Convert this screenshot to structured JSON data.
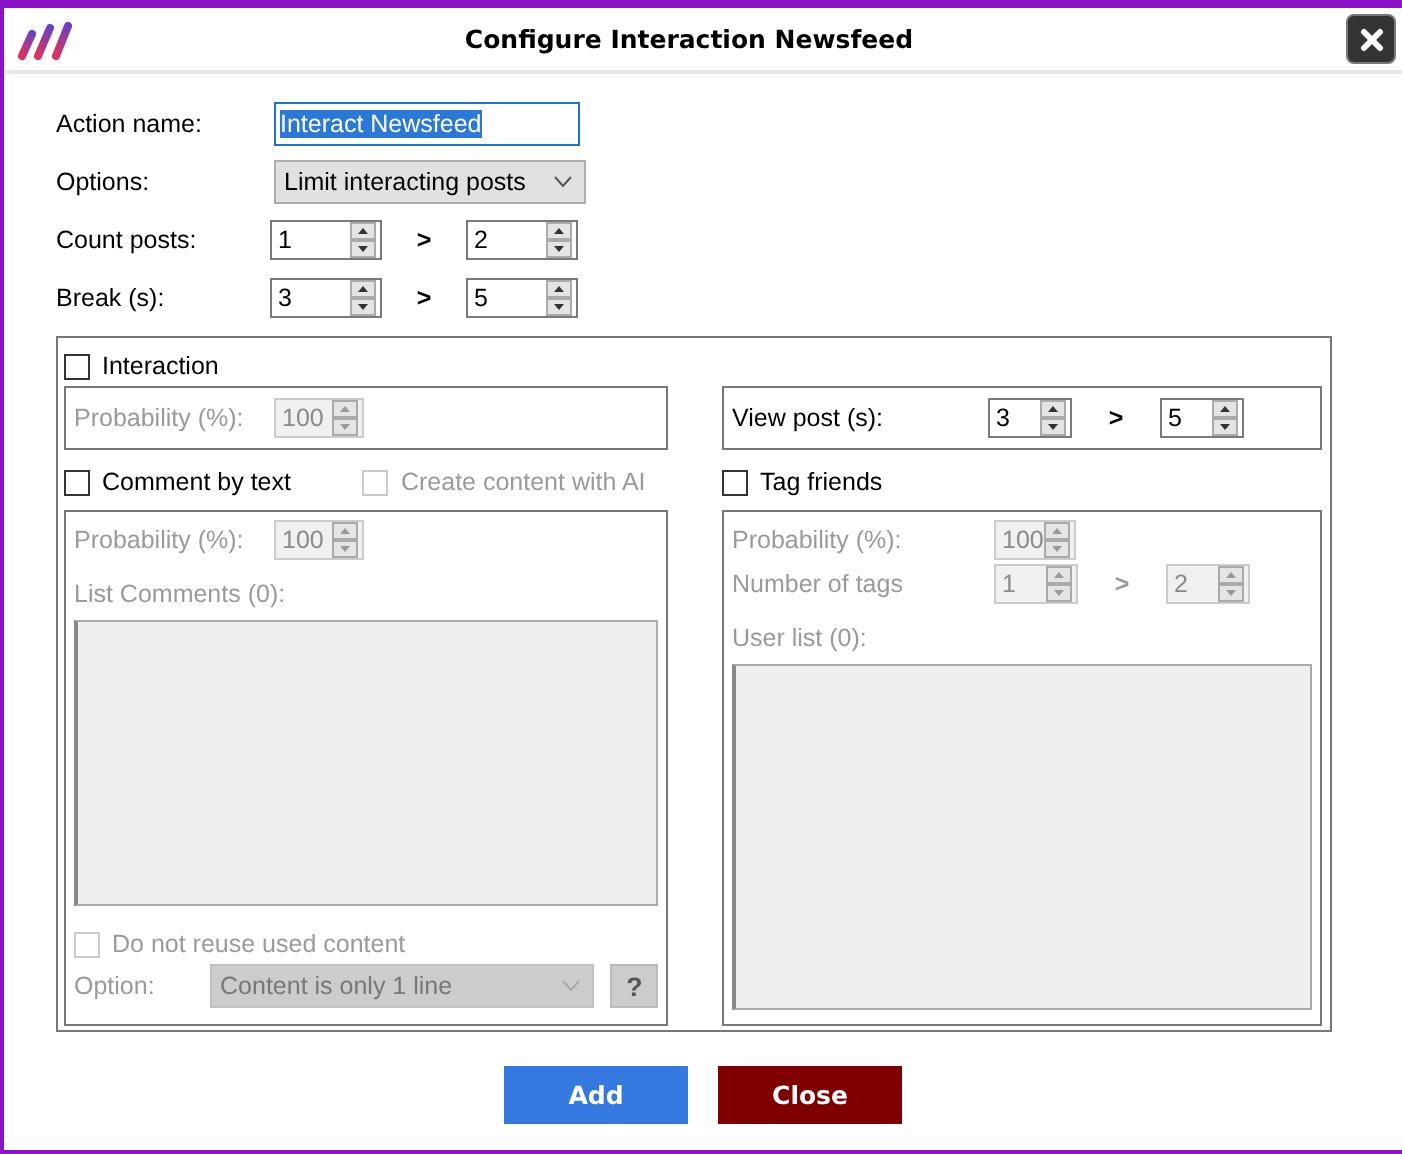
{
  "window": {
    "title": "Configure Interaction Newsfeed"
  },
  "action_name": {
    "label": "Action name:",
    "value": "Interact Newsfeed",
    "text_selected": true
  },
  "options": {
    "label": "Options:",
    "value": "Limit interacting posts"
  },
  "count_posts": {
    "label": "Count posts:",
    "from": "1",
    "separator": ">",
    "to": "2"
  },
  "break": {
    "label": "Break (s):",
    "from": "3",
    "separator": ">",
    "to": "5"
  },
  "interaction": {
    "label": "Interaction",
    "checked": false,
    "probability": {
      "label": "Probability (%):",
      "value": "100",
      "disabled": true
    }
  },
  "view_post": {
    "label": "View post (s):",
    "from": "3",
    "separator": ">",
    "to": "5"
  },
  "comment": {
    "label": "Comment by text",
    "checked": false,
    "ai": {
      "label": "Create content with AI",
      "checked": false,
      "disabled": true
    },
    "probability": {
      "label": "Probability (%):",
      "value": "100",
      "disabled": true
    },
    "list_label": "List Comments (0):",
    "reuse": {
      "label": "Do not reuse used content",
      "checked": false,
      "disabled": true
    },
    "option": {
      "label": "Option:",
      "value": "Content is only 1 line",
      "disabled": true
    },
    "help": "?"
  },
  "tag_friends": {
    "label": "Tag friends",
    "checked": false,
    "probability": {
      "label": "Probability (%):",
      "value": "100",
      "disabled": true
    },
    "tags": {
      "label": "Number of tags",
      "from": "1",
      "separator": ">",
      "to": "2",
      "disabled": true
    },
    "user_list_label": "User list (0):"
  },
  "buttons": [
    {
      "label": "Add",
      "kind": "primary"
    },
    {
      "label": "Close",
      "kind": "danger"
    }
  ]
}
